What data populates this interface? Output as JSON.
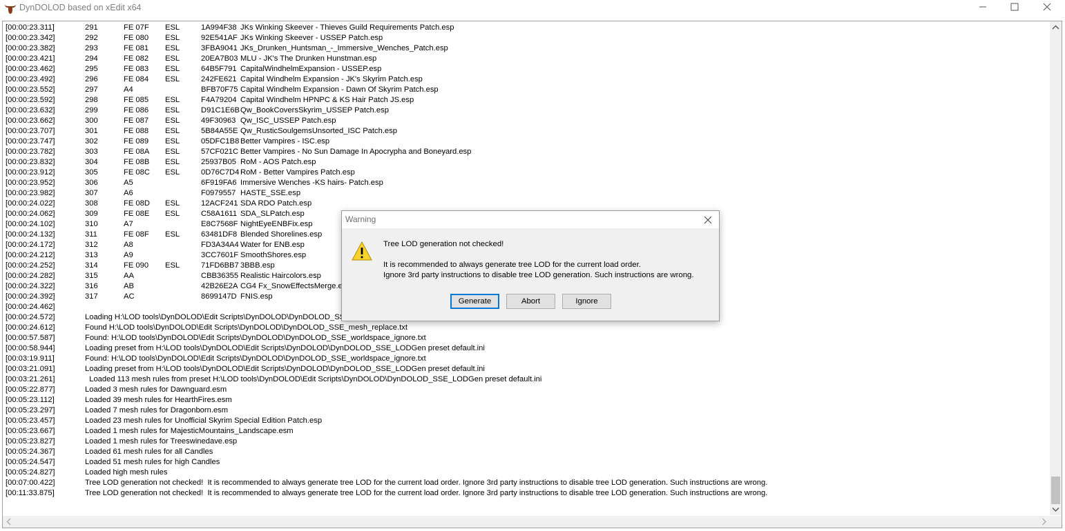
{
  "window": {
    "title": "DynDOLOD based on xEdit x64",
    "minimize_icon": "minimize-icon",
    "maximize_icon": "maximize-icon",
    "close_icon": "close-icon"
  },
  "log": {
    "plugin_rows": [
      {
        "ts": "[00:00:23.311]",
        "num": "291",
        "fe": "FE 07F",
        "esl": "ESL",
        "crc": "1A994F38",
        "file": "JKs Winking Skeever - Thieves Guild Requirements Patch.esp"
      },
      {
        "ts": "[00:00:23.342]",
        "num": "292",
        "fe": "FE 080",
        "esl": "ESL",
        "crc": "92E541AF",
        "file": "JKs Winking Skeever - USSEP Patch.esp"
      },
      {
        "ts": "[00:00:23.382]",
        "num": "293",
        "fe": "FE 081",
        "esl": "ESL",
        "crc": "3FBA9041",
        "file": "JKs_Drunken_Huntsman_-_Immersive_Wenches_Patch.esp"
      },
      {
        "ts": "[00:00:23.421]",
        "num": "294",
        "fe": "FE 082",
        "esl": "ESL",
        "crc": "20EA7B03",
        "file": "MLU - JK's The Drunken Hunstman.esp"
      },
      {
        "ts": "[00:00:23.462]",
        "num": "295",
        "fe": "FE 083",
        "esl": "ESL",
        "crc": "64B5F791",
        "file": "CapitalWindhelmExpansion - USSEP.esp"
      },
      {
        "ts": "[00:00:23.492]",
        "num": "296",
        "fe": "FE 084",
        "esl": "ESL",
        "crc": "242FE621",
        "file": "Capital Windhelm Expansion - JK's Skyrim Patch.esp"
      },
      {
        "ts": "[00:00:23.552]",
        "num": "297",
        "fe": "A4",
        "esl": "",
        "crc": "BFB70F75",
        "file": "Capital Windhelm Expansion - Dawn Of Skyrim Patch.esp"
      },
      {
        "ts": "[00:00:23.592]",
        "num": "298",
        "fe": "FE 085",
        "esl": "ESL",
        "crc": "F4A79204",
        "file": "Capital Windhelm HPNPC & KS Hair Patch JS.esp"
      },
      {
        "ts": "[00:00:23.632]",
        "num": "299",
        "fe": "FE 086",
        "esl": "ESL",
        "crc": "D91C1E6B",
        "file": "Qw_BookCoversSkyrim_USSEP Patch.esp"
      },
      {
        "ts": "[00:00:23.662]",
        "num": "300",
        "fe": "FE 087",
        "esl": "ESL",
        "crc": "49F30963",
        "file": "Qw_ISC_USSEP Patch.esp"
      },
      {
        "ts": "[00:00:23.707]",
        "num": "301",
        "fe": "FE 088",
        "esl": "ESL",
        "crc": "5B84A55E",
        "file": "Qw_RusticSoulgemsUnsorted_ISC Patch.esp"
      },
      {
        "ts": "[00:00:23.747]",
        "num": "302",
        "fe": "FE 089",
        "esl": "ESL",
        "crc": "05DFC1B8",
        "file": "Better Vampires - ISC.esp"
      },
      {
        "ts": "[00:00:23.782]",
        "num": "303",
        "fe": "FE 08A",
        "esl": "ESL",
        "crc": "57CF021C",
        "file": "Better Vampires - No Sun Damage In Apocrypha and Boneyard.esp"
      },
      {
        "ts": "[00:00:23.832]",
        "num": "304",
        "fe": "FE 08B",
        "esl": "ESL",
        "crc": "25937B05",
        "file": "RoM - AOS Patch.esp"
      },
      {
        "ts": "[00:00:23.912]",
        "num": "305",
        "fe": "FE 08C",
        "esl": "ESL",
        "crc": "0D76C7D4",
        "file": "RoM - Better Vampires Patch.esp"
      },
      {
        "ts": "[00:00:23.952]",
        "num": "306",
        "fe": "A5",
        "esl": "",
        "crc": "6F919FA6",
        "file": "Immersive Wenches -KS hairs- Patch.esp"
      },
      {
        "ts": "[00:00:23.982]",
        "num": "307",
        "fe": "A6",
        "esl": "",
        "crc": "F0979557",
        "file": "HASTE_SSE.esp"
      },
      {
        "ts": "[00:00:24.022]",
        "num": "308",
        "fe": "FE 08D",
        "esl": "ESL",
        "crc": "12ACF241",
        "file": "SDA RDO Patch.esp"
      },
      {
        "ts": "[00:00:24.062]",
        "num": "309",
        "fe": "FE 08E",
        "esl": "ESL",
        "crc": "C58A1611",
        "file": "SDA_SLPatch.esp"
      },
      {
        "ts": "[00:00:24.102]",
        "num": "310",
        "fe": "A7",
        "esl": "",
        "crc": "E8C7568F",
        "file": "NightEyeENBFix.esp"
      },
      {
        "ts": "[00:00:24.132]",
        "num": "311",
        "fe": "FE 08F",
        "esl": "ESL",
        "crc": "63481DF8",
        "file": "Blended Shorelines.esp"
      },
      {
        "ts": "[00:00:24.172]",
        "num": "312",
        "fe": "A8",
        "esl": "",
        "crc": "FD3A34A4",
        "file": "Water for ENB.esp"
      },
      {
        "ts": "[00:00:24.212]",
        "num": "313",
        "fe": "A9",
        "esl": "",
        "crc": "3CC7601F",
        "file": "SmoothShores.esp"
      },
      {
        "ts": "[00:00:24.252]",
        "num": "314",
        "fe": "FE 090",
        "esl": "ESL",
        "crc": "71FD6BB7",
        "file": "3BBB.esp"
      },
      {
        "ts": "[00:00:24.282]",
        "num": "315",
        "fe": "AA",
        "esl": "",
        "crc": "CBB36355",
        "file": "Realistic Haircolors.esp"
      },
      {
        "ts": "[00:00:24.322]",
        "num": "316",
        "fe": "AB",
        "esl": "",
        "crc": "42B26E2A",
        "file": "CG4 Fx_SnowEffectsMerge.esp"
      },
      {
        "ts": "[00:00:24.392]",
        "num": "317",
        "fe": "AC",
        "esl": "",
        "crc": "8699147D",
        "file": "FNIS.esp"
      }
    ],
    "message_rows": [
      {
        "ts": "[00:00:24.462]",
        "msg": ""
      },
      {
        "ts": "[00:00:24.572]",
        "msg": "Loading H:\\LOD tools\\DynDOLOD\\Edit Scripts\\DynDOLOD\\DynDOLOD_SSE_mesh_replace.txt"
      },
      {
        "ts": "[00:00:24.612]",
        "msg": "Found H:\\LOD tools\\DynDOLOD\\Edit Scripts\\DynDOLOD\\DynDOLOD_SSE_mesh_replace.txt"
      },
      {
        "ts": "[00:00:57.587]",
        "msg": "Found: H:\\LOD tools\\DynDOLOD\\Edit Scripts\\DynDOLOD\\DynDOLOD_SSE_worldspace_ignore.txt"
      },
      {
        "ts": "[00:00:58.944]",
        "msg": "Loading preset from H:\\LOD tools\\DynDOLOD\\Edit Scripts\\DynDOLOD\\DynDOLOD_SSE_LODGen preset default.ini"
      },
      {
        "ts": "[00:03:19.911]",
        "msg": "Found: H:\\LOD tools\\DynDOLOD\\Edit Scripts\\DynDOLOD\\DynDOLOD_SSE_worldspace_ignore.txt"
      },
      {
        "ts": "[00:03:21.091]",
        "msg": "Loading preset from H:\\LOD tools\\DynDOLOD\\Edit Scripts\\DynDOLOD\\DynDOLOD_SSE_LODGen preset default.ini"
      },
      {
        "ts": "[00:03:21.261]",
        "msg": "  Loaded 113 mesh rules from preset H:\\LOD tools\\DynDOLOD\\Edit Scripts\\DynDOLOD\\DynDOLOD_SSE_LODGen preset default.ini"
      },
      {
        "ts": "[00:05:22.877]",
        "msg": "Loaded 3 mesh rules for Dawnguard.esm"
      },
      {
        "ts": "[00:05:23.112]",
        "msg": "Loaded 39 mesh rules for HearthFires.esm"
      },
      {
        "ts": "[00:05:23.297]",
        "msg": "Loaded 7 mesh rules for Dragonborn.esm"
      },
      {
        "ts": "[00:05:23.457]",
        "msg": "Loaded 23 mesh rules for Unofficial Skyrim Special Edition Patch.esp"
      },
      {
        "ts": "[00:05:23.667]",
        "msg": "Loaded 1 mesh rules for MajesticMountains_Landscape.esm"
      },
      {
        "ts": "[00:05:23.827]",
        "msg": "Loaded 1 mesh rules for Treeswinedave.esp"
      },
      {
        "ts": "[00:05:24.367]",
        "msg": "Loaded 61 mesh rules for all Candles"
      },
      {
        "ts": "[00:05:24.547]",
        "msg": "Loaded 51 mesh rules for high Candles"
      },
      {
        "ts": "[00:05:24.827]",
        "msg": "Loaded high mesh rules"
      },
      {
        "ts": "[00:07:00.422]",
        "msg": "Tree LOD generation not checked!  It is recommended to always generate tree LOD for the current load order. Ignore 3rd party instructions to disable tree LOD generation. Such instructions are wrong."
      },
      {
        "ts": "[00:11:33.875]",
        "msg": "Tree LOD generation not checked!  It is recommended to always generate tree LOD for the current load order. Ignore 3rd party instructions to disable tree LOD generation. Such instructions are wrong."
      }
    ]
  },
  "dialog": {
    "title": "Warning",
    "icon": "warning-icon",
    "heading": "Tree LOD generation not checked!",
    "line1": "It is recommended to always generate tree LOD for the current load order.",
    "line2": "Ignore 3rd party instructions to disable tree LOD generation. Such instructions are wrong.",
    "buttons": {
      "generate": "Generate",
      "abort": "Abort",
      "ignore": "Ignore"
    }
  },
  "colors": {
    "warning_yellow": "#f8d22d",
    "focus_blue": "#0078d7"
  }
}
